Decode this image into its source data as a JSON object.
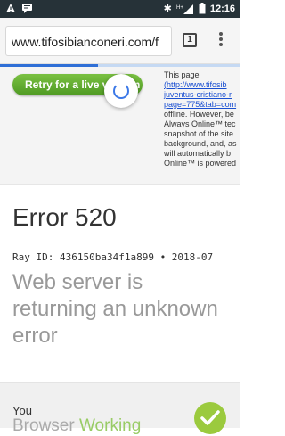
{
  "status_bar": {
    "time": "12:16"
  },
  "browser": {
    "url": "www.tifosibianconeri.com/f",
    "tab_count": "1"
  },
  "banner": {
    "retry_label": "Retry for a live version",
    "text_lines": [
      "This page",
      "(http://www.tifosib",
      "juventus-cristiano-r",
      "page=775&tab=com",
      "offline. However, be",
      "Always Online™ tec",
      "snapshot of the site",
      "background, and, as",
      "will automatically b",
      "Online™ is powered"
    ]
  },
  "error": {
    "title": "Error 520",
    "ray_id": "Ray ID: 436150ba34f1a899 • 2018-07",
    "subtitle": "Web server is returning an unknown error"
  },
  "status_section": {
    "you_label": "You",
    "browser_label": "Browser",
    "status_word": "Working"
  }
}
